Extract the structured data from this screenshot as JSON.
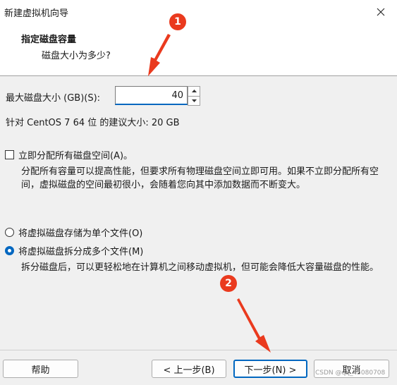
{
  "window": {
    "title": "新建虚拟机向导"
  },
  "header": {
    "title": "指定磁盘容量",
    "subtitle": "磁盘大小为多少?"
  },
  "disk_size": {
    "label": "最大磁盘大小 (GB)(S):",
    "value": "40",
    "recommendation": "针对 CentOS 7 64 位 的建议大小: 20 GB"
  },
  "allocate": {
    "label": "立即分配所有磁盘空间(A)。",
    "checked": false,
    "description": "分配所有容量可以提高性能，但要求所有物理磁盘空间立即可用。如果不立即分配所有空间，虚拟磁盘的空间最初很小，会随着您向其中添加数据而不断变大。"
  },
  "storage": {
    "options": [
      {
        "label": "将虚拟磁盘存储为单个文件(O)",
        "selected": false
      },
      {
        "label": "将虚拟磁盘拆分成多个文件(M)",
        "selected": true
      }
    ],
    "description": "拆分磁盘后，可以更轻松地在计算机之间移动虚拟机，但可能会降低大容量磁盘的性能。"
  },
  "buttons": {
    "help": "帮助",
    "back": "< 上一步(B)",
    "next": "下一步(N) >",
    "cancel": "取消"
  },
  "annotations": {
    "marker1": "1",
    "marker2": "2",
    "color": "#ea3a1e"
  },
  "watermark": "CSDN @qq_45080708",
  "colors": {
    "accent": "#0067c0",
    "background": "#f0f0f0",
    "header_bg": "#ffffff"
  },
  "icons": {
    "close": "close-icon",
    "spin_up": "chevron-up-icon",
    "spin_down": "chevron-down-icon"
  }
}
